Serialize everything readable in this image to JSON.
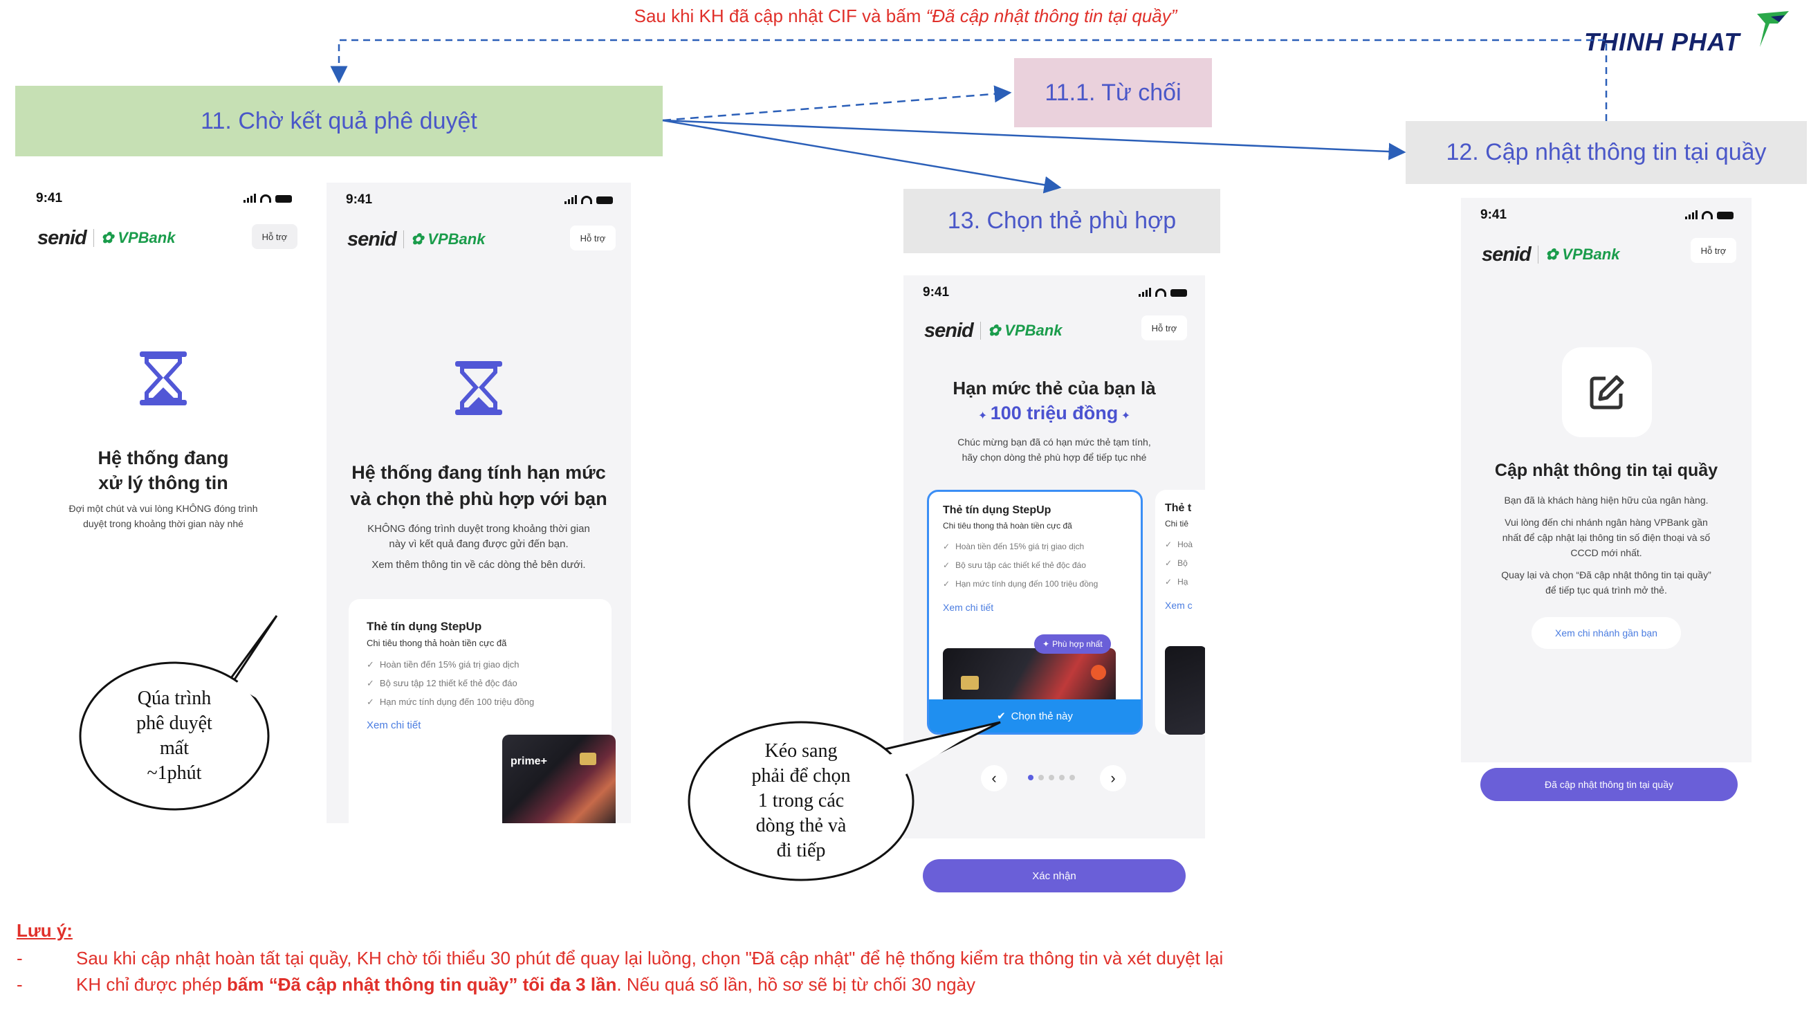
{
  "top_note": {
    "prefix": "Sau khi KH đã cập nhật CIF và bấm ",
    "quoted": "“Đã cập nhật thông tin tại quầy”"
  },
  "logo": {
    "text": "THINH PHAT"
  },
  "steps": {
    "s11": {
      "label": "11. Chờ kết quả phê duyệt",
      "color": "#c6e0b4"
    },
    "s11_1": {
      "label": "11.1. Từ chối",
      "color": "#ead1dc"
    },
    "s12": {
      "label": "12. Cập nhật thông tin tại quầy",
      "color": "#e7e7e7"
    },
    "s13": {
      "label": "13. Chọn thẻ phù hợp",
      "color": "#e7e7e7"
    }
  },
  "common": {
    "time": "9:41",
    "senid": "senid",
    "vpbank": "VPBank",
    "support": "Hỗ trợ"
  },
  "screen1": {
    "title1": "Hệ thống đang",
    "title2": "xử lý thông tin",
    "desc1": "Đợi một chút và vui lòng KHÔNG đóng trình",
    "desc2": "duyệt trong khoảng thời gian này nhé"
  },
  "screen2": {
    "title1": "Hệ thống đang tính hạn mức",
    "title2": "và chọn thẻ phù hợp với bạn",
    "desc1": "KHÔNG đóng trình duyệt trong khoảng thời gian",
    "desc2": "này vì kết quả đang được gửi đến bạn.",
    "desc3": "Xem thêm thông tin về các dòng thẻ bên dưới.",
    "card": {
      "title": "Thẻ tín dụng StepUp",
      "subtitle": "Chi tiêu thong thả hoàn tiền cực đã",
      "features": [
        "Hoàn tiền đến 15% giá trị giao dịch",
        "Bộ sưu tập 12 thiết kế thẻ độc đáo",
        "Hạn mức tính dụng đến 100 triệu đồng"
      ],
      "link": "Xem chi tiết",
      "brand": "prime+"
    }
  },
  "screen3": {
    "title": "Hạn mức thẻ của bạn là",
    "amount": "100 triệu đồng",
    "desc1": "Chúc mừng bạn đã có hạn mức thẻ tạm tính,",
    "desc2": "hãy chọn dòng thẻ phù hợp để tiếp tục nhé",
    "card": {
      "title": "Thẻ tín dụng StepUp",
      "subtitle": "Chi tiêu thong thả hoàn tiền cực đã",
      "features": [
        "Hoàn tiền đến 15% giá trị giao dịch",
        "Bộ sưu tập các thiết kế thẻ độc đáo",
        "Hạn mức tính dụng đến 100 triệu đồng"
      ],
      "link": "Xem chi tiết",
      "badge": "Phù hợp nhất",
      "select": "Chọn thẻ này"
    },
    "peek": {
      "title": "Thẻ t",
      "subtitle": "Chi tiê",
      "features": [
        "Hoà",
        "Bộ",
        "Hạ"
      ],
      "link": "Xem c"
    },
    "confirm": "Xác nhận"
  },
  "screen4": {
    "title": "Cập nhật thông tin tại quầy",
    "desc1": "Bạn đã là khách hàng hiện hữu của ngân hàng.",
    "desc2": "Vui lòng đến chi nhánh ngân hàng VPBank gần",
    "desc3": "nhất để cập nhật lại thông tin số điện thoại và số",
    "desc4": "CCCD mới nhất.",
    "desc5": "Quay lại và chọn “Đã cập nhật thông tin tại quầy”",
    "desc6": "để tiếp tục quá trình mở thẻ.",
    "branch": "Xem chi nhánh gần bạn",
    "button": "Đã cập nhật thông tin tại quầy"
  },
  "bubbles": {
    "b1": [
      "Qúa trình",
      "phê duyệt",
      "mất",
      "~1phút"
    ],
    "b2": [
      "Kéo sang",
      "phải để chọn",
      "1 trong các",
      "dòng thẻ và",
      "đi tiếp"
    ]
  },
  "notes": {
    "heading": "Lưu ý:",
    "line1": "Sau khi cập nhật hoàn tất tại quầy,  KH chờ tối thiểu 30 phút để quay lại luồng, chọn \"Đã cập nhật\" để hệ thống kiểm tra thông tin  và xét duyệt lại",
    "line2_pre": "KH chỉ được phép ",
    "line2_bold": "bấm “Đã cập nhật thông tin quầy” tối đa 3 lần",
    "line2_post": ".  Nếu quá số lần, hồ sơ sẽ bị từ chối 30 ngày"
  }
}
